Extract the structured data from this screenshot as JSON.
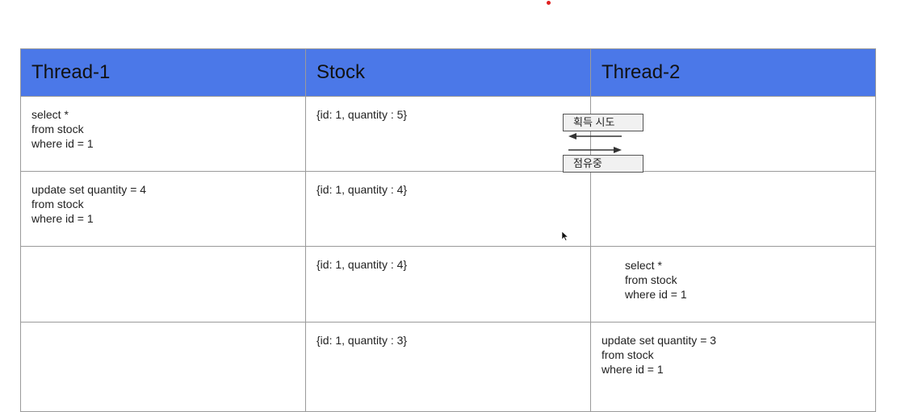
{
  "headers": [
    "Thread-1",
    "Stock",
    "Thread-2"
  ],
  "rows": [
    {
      "thread1": "select *\nfrom stock\nwhere id = 1",
      "stock": "{id: 1, quantity : 5}",
      "thread2": ""
    },
    {
      "thread1": "update set quantity = 4\nfrom stock\nwhere id = 1",
      "stock": "{id: 1, quantity : 4}",
      "thread2": ""
    },
    {
      "thread1": "",
      "stock": "{id: 1, quantity : 4}",
      "thread2": "select *\nfrom stock\nwhere id = 1"
    },
    {
      "thread1": "",
      "stock": "{id: 1, quantity : 3}",
      "thread2": "update set quantity = 3\nfrom stock\nwhere id = 1"
    }
  ],
  "annotations": {
    "acquire_attempt": "획득 시도",
    "occupied": "점유중"
  },
  "colors": {
    "header_bg": "#4b78e8",
    "grid_line": "#9a9a9a",
    "marker_dot": "#e02020"
  }
}
